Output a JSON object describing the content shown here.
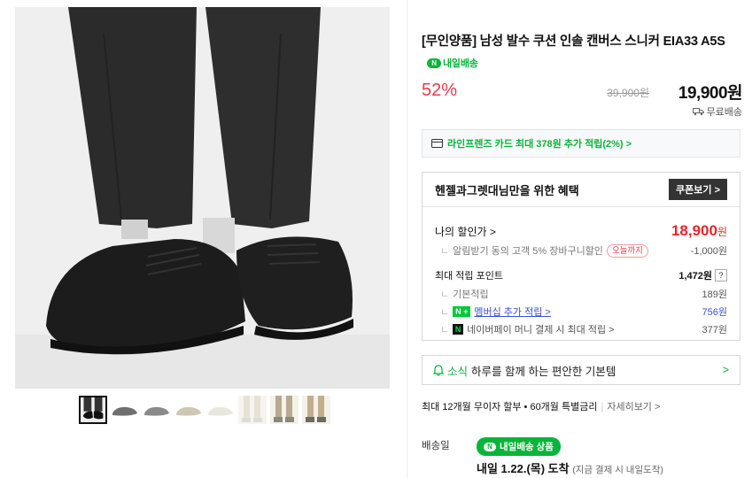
{
  "product": {
    "title": "[무인양품] 남성 발수 쿠션 인솔 캔버스 스니커 EIA33 A5S",
    "tomorrow_badge": "내일배송",
    "discount": "52%",
    "price_original": "39,900원",
    "price_final": "19,900원",
    "shipping": "무료배송"
  },
  "card_promo": "라인프렌즈 카드 최대 378원 추가 적립(2%) >",
  "benefit": {
    "title": "헨젤과그렛대님만을 위한 혜택",
    "coupon_button": "쿠폰보기 >",
    "my_price_label": "나의 할인가 >",
    "my_price_value": "18,900",
    "my_price_unit": "원",
    "alarm_discount_label": "알림받기 동의 고객 5% 장바구니할인",
    "alarm_discount_tag": "오늘까지",
    "alarm_discount_value": "-1,000원",
    "points_label": "최대 적립 포인트",
    "points_value": "1,472원",
    "points_help": "?",
    "basic_points_label": "기본적립",
    "basic_points_value": "189원",
    "membership_badge": "N +",
    "membership_label": "멤버십 추가 적립 >",
    "membership_value": "756원",
    "npay_badge": "N",
    "npay_label": "네이버페이 머니 결제 시 최대 적립 >",
    "npay_value": "377원"
  },
  "news": {
    "highlight": "소식",
    "text": "하루를 함께 하는 편안한 기본템",
    "arrow": ">"
  },
  "installment": {
    "text": "최대 12개월 무이자 할부 • 60개월 특별금리",
    "more": "자세히보기 >"
  },
  "delivery": {
    "label": "배송일",
    "badge": "내일배송 상품",
    "badge_icon": "N",
    "date": "내일 1.22.(목) 도착",
    "note": "(지금 결제 시 내일도착)"
  },
  "colors": {
    "accent_green": "#07b53b",
    "discount_red": "#f0384e",
    "price_red": "#e8252a"
  }
}
